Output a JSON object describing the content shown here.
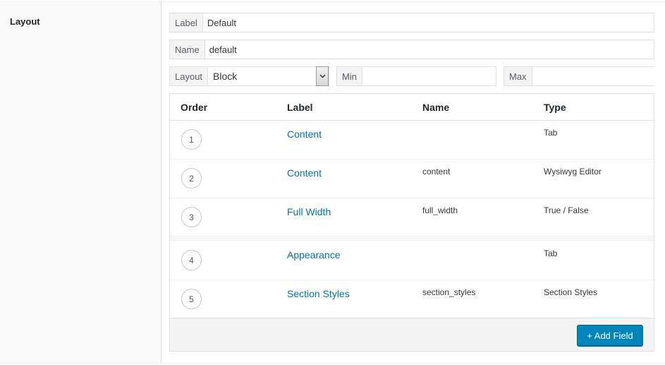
{
  "section": {
    "title": "Layout"
  },
  "fields": {
    "label": {
      "prepend": "Label",
      "value": "Default"
    },
    "name": {
      "prepend": "Name",
      "value": "default"
    },
    "layout": {
      "prepend": "Layout",
      "value": "Block"
    },
    "min": {
      "prepend": "Min",
      "value": ""
    },
    "max": {
      "prepend": "Max",
      "value": ""
    }
  },
  "table": {
    "headers": {
      "order": "Order",
      "label": "Label",
      "name": "Name",
      "type": "Type"
    },
    "rows": [
      {
        "order": "1",
        "label": "Content",
        "name": "",
        "type": "Tab"
      },
      {
        "order": "2",
        "label": "Content",
        "name": "content",
        "type": "Wysiwyg Editor"
      },
      {
        "order": "3",
        "label": "Full Width",
        "name": "full_width",
        "type": "True / False"
      },
      {
        "order": "4",
        "label": "Appearance",
        "name": "",
        "type": "Tab"
      },
      {
        "order": "5",
        "label": "Section Styles",
        "name": "section_styles",
        "type": "Section Styles"
      }
    ]
  },
  "footer": {
    "add_field_label": "+ Add Field"
  },
  "colors": {
    "accent": "#0085ba",
    "link": "#0073aa"
  },
  "icons": {
    "select_arrow": "chevron-down-icon"
  }
}
